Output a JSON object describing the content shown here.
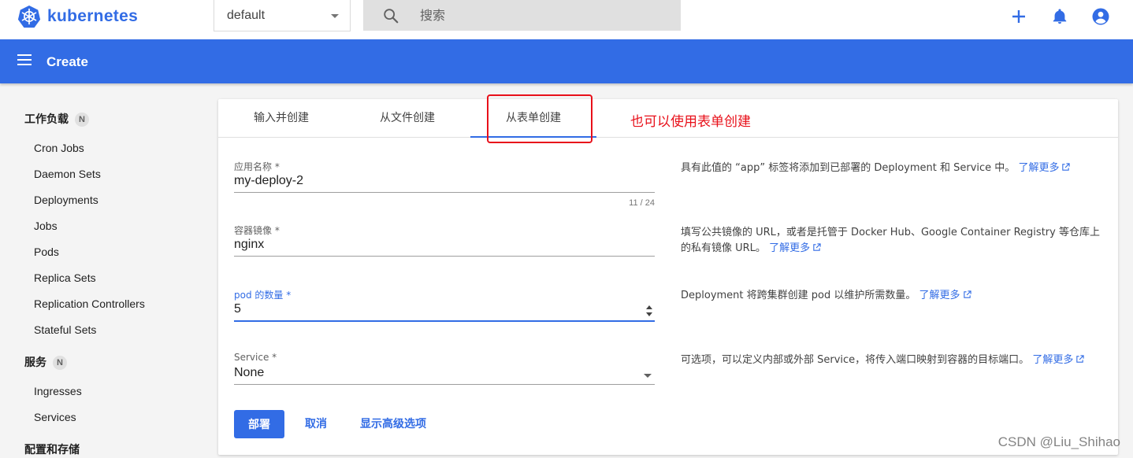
{
  "app": {
    "brand": "kubernetes"
  },
  "topbar": {
    "namespace": "default",
    "search_placeholder": "搜索",
    "icons": [
      "plus-icon",
      "bell-icon",
      "account-icon"
    ]
  },
  "header": {
    "title": "Create"
  },
  "sidebar": {
    "workloads": {
      "title": "工作负载",
      "badge": "N",
      "items": [
        "Cron Jobs",
        "Daemon Sets",
        "Deployments",
        "Jobs",
        "Pods",
        "Replica Sets",
        "Replication Controllers",
        "Stateful Sets"
      ]
    },
    "services": {
      "title": "服务",
      "badge": "N",
      "items": [
        "Ingresses",
        "Services"
      ]
    },
    "config": {
      "title": "配置和存储"
    }
  },
  "tabs": [
    "输入并创建",
    "从文件创建",
    "从表单创建"
  ],
  "active_tab": 2,
  "annotation": "也可以使用表单创建",
  "form": {
    "app_name": {
      "label": "应用名称 *",
      "value": "my-deploy-2",
      "counter": "11 / 24",
      "help": "具有此值的 “app” 标签将添加到已部署的 Deployment 和 Service 中。"
    },
    "image": {
      "label": "容器镜像 *",
      "value": "nginx",
      "help": "填写公共镜像的 URL，或者是托管于 Docker Hub、Google Container Registry 等仓库上的私有镜像 URL。"
    },
    "pods": {
      "label": "pod 的数量 *",
      "value": "5",
      "help": "Deployment 将跨集群创建 pod 以维护所需数量。"
    },
    "service": {
      "label": "Service *",
      "value": "None",
      "help": "可选项，可以定义内部或外部 Service，将传入端口映射到容器的目标端口。"
    },
    "learn_more": "了解更多"
  },
  "actions": {
    "deploy": "部署",
    "cancel": "取消",
    "advanced": "显示高级选项"
  },
  "watermark": "CSDN @Liu_Shihao",
  "colors": {
    "primary": "#326ce5",
    "annotation": "#e8101a"
  }
}
